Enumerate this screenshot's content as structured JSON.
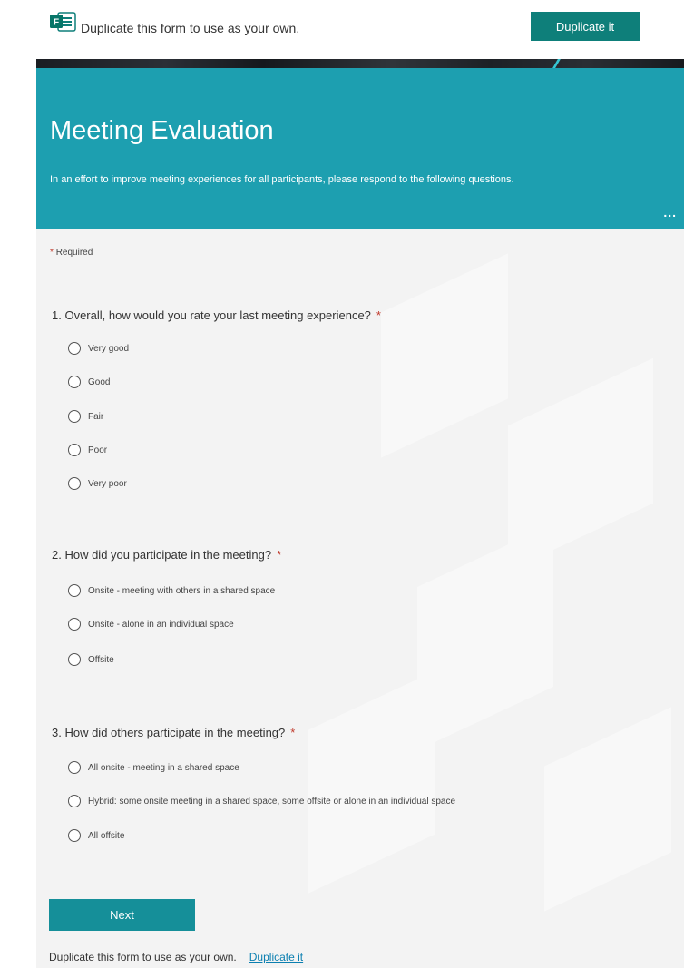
{
  "topbar": {
    "message": "Duplicate this form to use as your own.",
    "duplicate_button": "Duplicate it",
    "logo_icon": "microsoft-forms-icon"
  },
  "header": {
    "title": "Meeting Evaluation",
    "description": "In an effort to improve meeting experiences for all participants, please respond to the following questions.",
    "more_label": "...",
    "background_color": "#1d9fb0"
  },
  "form": {
    "required_star": "*",
    "required_label": "Required",
    "questions": [
      {
        "text": "1. Overall, how would you rate your last meeting experience?",
        "required_star": "*",
        "options": [
          "Very good",
          "Good",
          "Fair",
          "Poor",
          "Very poor"
        ]
      },
      {
        "text": "2. How did you participate in the meeting?",
        "required_star": "*",
        "options": [
          "Onsite -  meeting with others in a shared space",
          "Onsite - alone in an individual space",
          "Offsite"
        ]
      },
      {
        "text": "3. How did others participate in the meeting?",
        "required_star": "*",
        "options": [
          "All onsite - meeting in a shared space",
          "Hybrid:  some onsite meeting in a shared space, some offsite or alone in an individual space",
          "All offsite"
        ]
      }
    ],
    "next_button": "Next"
  },
  "footer": {
    "message": "Duplicate this form to use as your own.",
    "link": "Duplicate it"
  },
  "colors": {
    "accent": "#0e7f7a",
    "header": "#1d9fb0",
    "link": "#0b7fb0",
    "required": "#c0392b"
  }
}
